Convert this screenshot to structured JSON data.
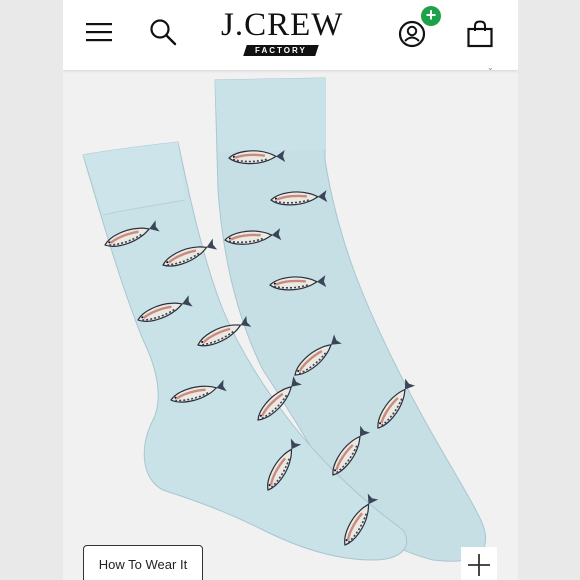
{
  "header": {
    "brand_name": "J.CREW",
    "brand_sub": "FACTORY",
    "badge_symbol": "+"
  },
  "product": {
    "wear_button_label": "How To Wear It"
  },
  "colors": {
    "sock": "#c9e1e6",
    "badge": "#1fa04a"
  },
  "icons": [
    "menu-icon",
    "search-icon",
    "account-icon",
    "bag-icon",
    "plus-icon"
  ]
}
